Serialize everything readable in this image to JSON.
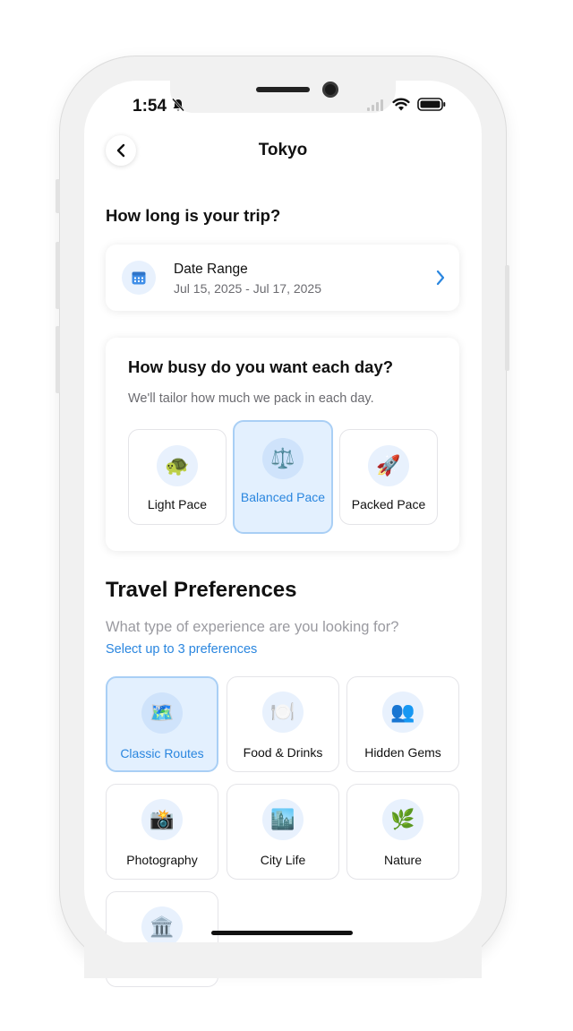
{
  "status_bar": {
    "time": "1:54"
  },
  "header": {
    "title": "Tokyo"
  },
  "trip_length": {
    "question": "How long is your trip?",
    "date_label": "Date Range",
    "date_value": "Jul 15, 2025 - Jul 17, 2025"
  },
  "pace": {
    "question": "How busy do you want each day?",
    "subtitle": "We'll tailor how much we pack in each day.",
    "options": [
      {
        "label": "Light Pace",
        "icon": "🐢",
        "icon_name": "turtle-icon",
        "selected": false
      },
      {
        "label": "Balanced Pace",
        "icon": "⚖️",
        "icon_name": "scales-icon",
        "selected": true
      },
      {
        "label": "Packed Pace",
        "icon": "🚀",
        "icon_name": "rocket-icon",
        "selected": false
      }
    ]
  },
  "preferences": {
    "title": "Travel Preferences",
    "subtitle": "What type of experience are you looking for?",
    "limit": "Select up to 3 preferences",
    "items": [
      {
        "label": "Classic Routes",
        "icon": "🗺️",
        "icon_name": "map-icon",
        "selected": true
      },
      {
        "label": "Food & Drinks",
        "icon": "🍽️",
        "icon_name": "plate-icon",
        "selected": false
      },
      {
        "label": "Hidden Gems",
        "icon": "👥",
        "icon_name": "people-icon",
        "selected": false
      },
      {
        "label": "Photography",
        "icon": "📸",
        "icon_name": "camera-icon",
        "selected": false
      },
      {
        "label": "City Life",
        "icon": "🏙️",
        "icon_name": "city-icon",
        "selected": false
      },
      {
        "label": "Nature",
        "icon": "🌿",
        "icon_name": "leaf-icon",
        "selected": false
      },
      {
        "label": "",
        "icon": "🏛️",
        "icon_name": "museum-icon",
        "selected": false
      }
    ]
  },
  "colors": {
    "accent": "#2a86df",
    "selected_bg": "#e3f0fe",
    "icon_bg": "#e8f1fd"
  }
}
